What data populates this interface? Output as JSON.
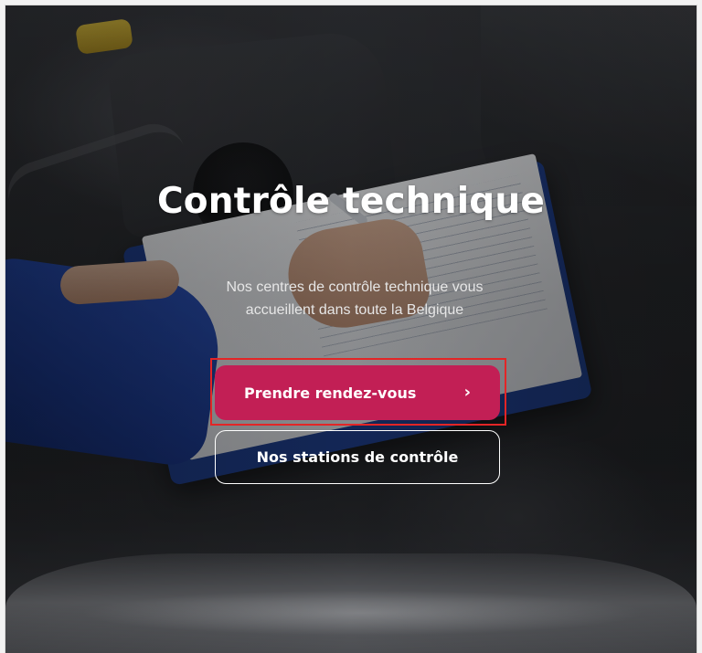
{
  "hero": {
    "title": "Contrôle technique",
    "subtitle": "Nos centres de contrôle technique vous accueillent dans toute la Belgique"
  },
  "actions": {
    "primary_label": "Prendre rendez-vous",
    "primary_icon": "chevron-right-icon",
    "primary_glyph": "›",
    "secondary_label": "Nos stations de contrôle"
  },
  "colors": {
    "primary_button": "#c21f55",
    "highlight_border": "#e32526",
    "text": "#ffffff"
  }
}
